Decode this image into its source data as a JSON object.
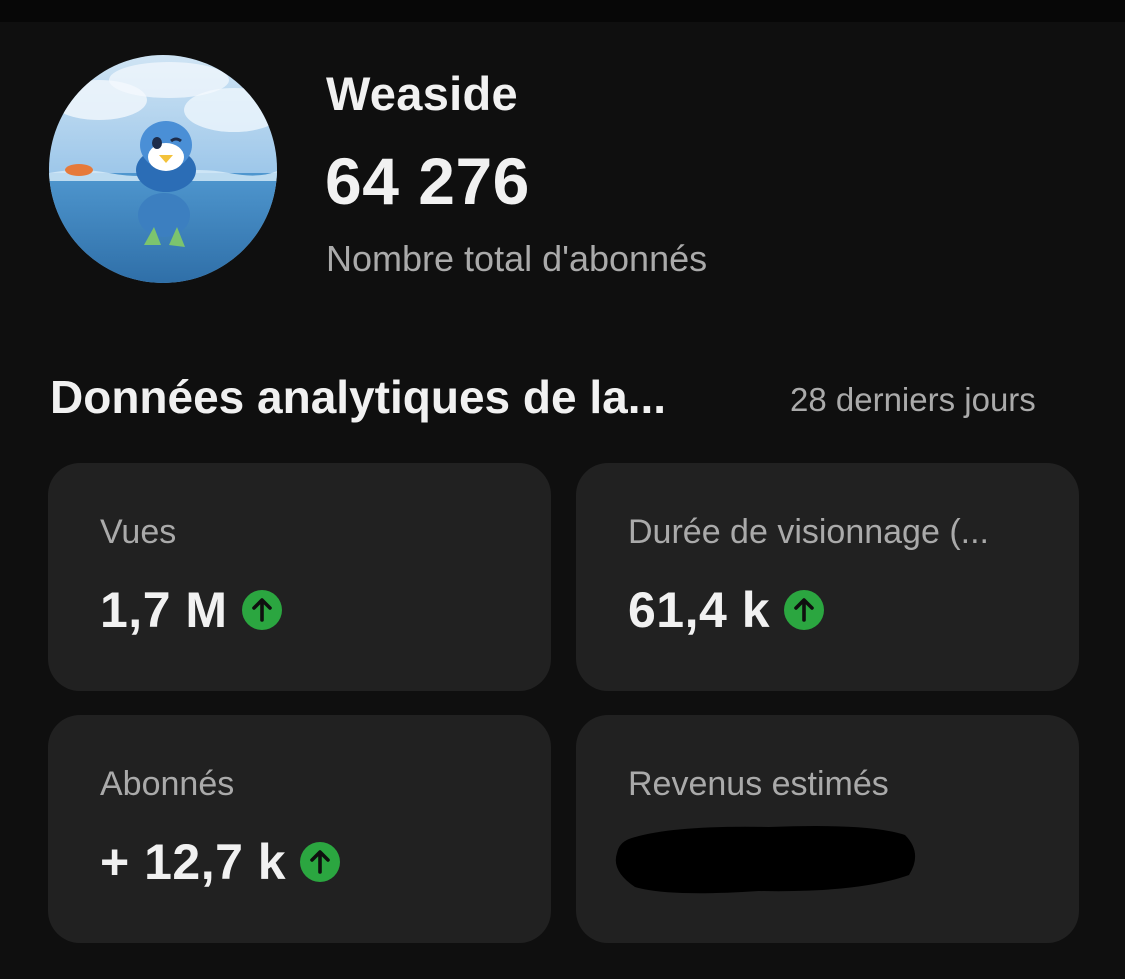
{
  "channel": {
    "name": "Weaside",
    "subscriber_count": "64 276",
    "subscriber_label": "Nombre total d'abonnés",
    "avatar_icon": "channel-avatar-piplup"
  },
  "analytics": {
    "title": "Données analytiques de la...",
    "period": "28 derniers jours",
    "cards": [
      {
        "label": "Vues",
        "value": "1,7 M",
        "trend": "up",
        "trend_icon": "arrow-up-icon"
      },
      {
        "label": "Durée de visionnage (...",
        "value": "61,4 k",
        "trend": "up",
        "trend_icon": "arrow-up-icon"
      },
      {
        "label": "Abonnés",
        "value": "+ 12,7 k",
        "trend": "up",
        "trend_icon": "arrow-up-icon"
      },
      {
        "label": "Revenus estimés",
        "value": "",
        "redacted": true
      }
    ]
  },
  "colors": {
    "background": "#0f0f0f",
    "card": "#212121",
    "secondary_text": "#aaaaaa",
    "trend_up": "#2ba640"
  }
}
